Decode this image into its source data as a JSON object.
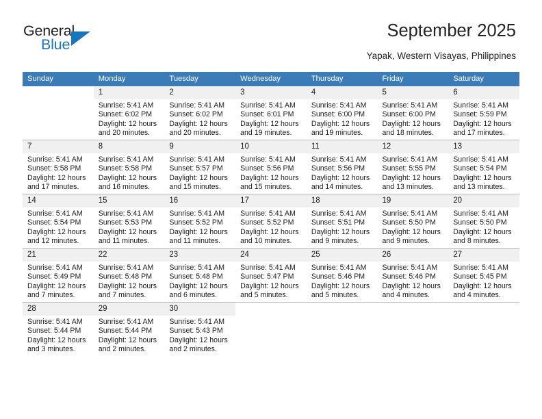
{
  "logo": {
    "text_top": "General",
    "text_bottom": "Blue",
    "accent_color": "#1b75bb",
    "dark_color": "#231f20"
  },
  "header": {
    "title": "September 2025",
    "location": "Yapak, Western Visayas, Philippines"
  },
  "theme": {
    "header_row_bg": "#3b7cb8",
    "daynum_bg": "#f0f0f0",
    "grid_line": "#b9b9b9",
    "text": "#1a1a1a"
  },
  "weekdays": [
    "Sunday",
    "Monday",
    "Tuesday",
    "Wednesday",
    "Thursday",
    "Friday",
    "Saturday"
  ],
  "labels": {
    "sunrise_prefix": "Sunrise:",
    "sunset_prefix": "Sunset:",
    "daylight_prefix": "Daylight:"
  },
  "weeks": [
    [
      {
        "day": "",
        "blank": true,
        "sunrise": "",
        "sunset": "",
        "daylight": ""
      },
      {
        "day": "1",
        "sunrise": "Sunrise: 5:41 AM",
        "sunset": "Sunset: 6:02 PM",
        "daylight": "Daylight: 12 hours and 20 minutes."
      },
      {
        "day": "2",
        "sunrise": "Sunrise: 5:41 AM",
        "sunset": "Sunset: 6:02 PM",
        "daylight": "Daylight: 12 hours and 20 minutes."
      },
      {
        "day": "3",
        "sunrise": "Sunrise: 5:41 AM",
        "sunset": "Sunset: 6:01 PM",
        "daylight": "Daylight: 12 hours and 19 minutes."
      },
      {
        "day": "4",
        "sunrise": "Sunrise: 5:41 AM",
        "sunset": "Sunset: 6:00 PM",
        "daylight": "Daylight: 12 hours and 19 minutes."
      },
      {
        "day": "5",
        "sunrise": "Sunrise: 5:41 AM",
        "sunset": "Sunset: 6:00 PM",
        "daylight": "Daylight: 12 hours and 18 minutes."
      },
      {
        "day": "6",
        "sunrise": "Sunrise: 5:41 AM",
        "sunset": "Sunset: 5:59 PM",
        "daylight": "Daylight: 12 hours and 17 minutes."
      }
    ],
    [
      {
        "day": "7",
        "sunrise": "Sunrise: 5:41 AM",
        "sunset": "Sunset: 5:58 PM",
        "daylight": "Daylight: 12 hours and 17 minutes."
      },
      {
        "day": "8",
        "sunrise": "Sunrise: 5:41 AM",
        "sunset": "Sunset: 5:58 PM",
        "daylight": "Daylight: 12 hours and 16 minutes."
      },
      {
        "day": "9",
        "sunrise": "Sunrise: 5:41 AM",
        "sunset": "Sunset: 5:57 PM",
        "daylight": "Daylight: 12 hours and 15 minutes."
      },
      {
        "day": "10",
        "sunrise": "Sunrise: 5:41 AM",
        "sunset": "Sunset: 5:56 PM",
        "daylight": "Daylight: 12 hours and 15 minutes."
      },
      {
        "day": "11",
        "sunrise": "Sunrise: 5:41 AM",
        "sunset": "Sunset: 5:56 PM",
        "daylight": "Daylight: 12 hours and 14 minutes."
      },
      {
        "day": "12",
        "sunrise": "Sunrise: 5:41 AM",
        "sunset": "Sunset: 5:55 PM",
        "daylight": "Daylight: 12 hours and 13 minutes."
      },
      {
        "day": "13",
        "sunrise": "Sunrise: 5:41 AM",
        "sunset": "Sunset: 5:54 PM",
        "daylight": "Daylight: 12 hours and 13 minutes."
      }
    ],
    [
      {
        "day": "14",
        "sunrise": "Sunrise: 5:41 AM",
        "sunset": "Sunset: 5:54 PM",
        "daylight": "Daylight: 12 hours and 12 minutes."
      },
      {
        "day": "15",
        "sunrise": "Sunrise: 5:41 AM",
        "sunset": "Sunset: 5:53 PM",
        "daylight": "Daylight: 12 hours and 11 minutes."
      },
      {
        "day": "16",
        "sunrise": "Sunrise: 5:41 AM",
        "sunset": "Sunset: 5:52 PM",
        "daylight": "Daylight: 12 hours and 11 minutes."
      },
      {
        "day": "17",
        "sunrise": "Sunrise: 5:41 AM",
        "sunset": "Sunset: 5:52 PM",
        "daylight": "Daylight: 12 hours and 10 minutes."
      },
      {
        "day": "18",
        "sunrise": "Sunrise: 5:41 AM",
        "sunset": "Sunset: 5:51 PM",
        "daylight": "Daylight: 12 hours and 9 minutes."
      },
      {
        "day": "19",
        "sunrise": "Sunrise: 5:41 AM",
        "sunset": "Sunset: 5:50 PM",
        "daylight": "Daylight: 12 hours and 9 minutes."
      },
      {
        "day": "20",
        "sunrise": "Sunrise: 5:41 AM",
        "sunset": "Sunset: 5:50 PM",
        "daylight": "Daylight: 12 hours and 8 minutes."
      }
    ],
    [
      {
        "day": "21",
        "sunrise": "Sunrise: 5:41 AM",
        "sunset": "Sunset: 5:49 PM",
        "daylight": "Daylight: 12 hours and 7 minutes."
      },
      {
        "day": "22",
        "sunrise": "Sunrise: 5:41 AM",
        "sunset": "Sunset: 5:48 PM",
        "daylight": "Daylight: 12 hours and 7 minutes."
      },
      {
        "day": "23",
        "sunrise": "Sunrise: 5:41 AM",
        "sunset": "Sunset: 5:48 PM",
        "daylight": "Daylight: 12 hours and 6 minutes."
      },
      {
        "day": "24",
        "sunrise": "Sunrise: 5:41 AM",
        "sunset": "Sunset: 5:47 PM",
        "daylight": "Daylight: 12 hours and 5 minutes."
      },
      {
        "day": "25",
        "sunrise": "Sunrise: 5:41 AM",
        "sunset": "Sunset: 5:46 PM",
        "daylight": "Daylight: 12 hours and 5 minutes."
      },
      {
        "day": "26",
        "sunrise": "Sunrise: 5:41 AM",
        "sunset": "Sunset: 5:46 PM",
        "daylight": "Daylight: 12 hours and 4 minutes."
      },
      {
        "day": "27",
        "sunrise": "Sunrise: 5:41 AM",
        "sunset": "Sunset: 5:45 PM",
        "daylight": "Daylight: 12 hours and 4 minutes."
      }
    ],
    [
      {
        "day": "28",
        "sunrise": "Sunrise: 5:41 AM",
        "sunset": "Sunset: 5:44 PM",
        "daylight": "Daylight: 12 hours and 3 minutes."
      },
      {
        "day": "29",
        "sunrise": "Sunrise: 5:41 AM",
        "sunset": "Sunset: 5:44 PM",
        "daylight": "Daylight: 12 hours and 2 minutes."
      },
      {
        "day": "30",
        "sunrise": "Sunrise: 5:41 AM",
        "sunset": "Sunset: 5:43 PM",
        "daylight": "Daylight: 12 hours and 2 minutes."
      },
      {
        "day": "",
        "blank": true,
        "sunrise": "",
        "sunset": "",
        "daylight": ""
      },
      {
        "day": "",
        "blank": true,
        "sunrise": "",
        "sunset": "",
        "daylight": ""
      },
      {
        "day": "",
        "blank": true,
        "sunrise": "",
        "sunset": "",
        "daylight": ""
      },
      {
        "day": "",
        "blank": true,
        "sunrise": "",
        "sunset": "",
        "daylight": ""
      }
    ]
  ]
}
